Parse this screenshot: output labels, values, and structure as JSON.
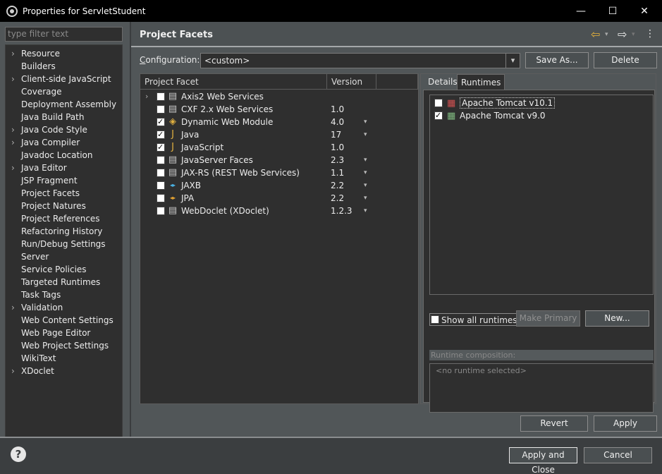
{
  "window": {
    "title": "Properties for ServletStudent",
    "minimize": "—",
    "maximize": "☐",
    "close": "✕"
  },
  "filter": {
    "placeholder": "type filter text"
  },
  "tree": [
    {
      "label": "Resource",
      "expandable": true
    },
    {
      "label": "Builders",
      "expandable": false
    },
    {
      "label": "Client-side JavaScript",
      "expandable": true
    },
    {
      "label": "Coverage",
      "expandable": false
    },
    {
      "label": "Deployment Assembly",
      "expandable": false
    },
    {
      "label": "Java Build Path",
      "expandable": false
    },
    {
      "label": "Java Code Style",
      "expandable": true
    },
    {
      "label": "Java Compiler",
      "expandable": true
    },
    {
      "label": "Javadoc Location",
      "expandable": false
    },
    {
      "label": "Java Editor",
      "expandable": true
    },
    {
      "label": "JSP Fragment",
      "expandable": false
    },
    {
      "label": "Project Facets",
      "expandable": false,
      "selected": true
    },
    {
      "label": "Project Natures",
      "expandable": false
    },
    {
      "label": "Project References",
      "expandable": false
    },
    {
      "label": "Refactoring History",
      "expandable": false
    },
    {
      "label": "Run/Debug Settings",
      "expandable": false
    },
    {
      "label": "Server",
      "expandable": false
    },
    {
      "label": "Service Policies",
      "expandable": false
    },
    {
      "label": "Targeted Runtimes",
      "expandable": false
    },
    {
      "label": "Task Tags",
      "expandable": false
    },
    {
      "label": "Validation",
      "expandable": true
    },
    {
      "label": "Web Content Settings",
      "expandable": false
    },
    {
      "label": "Web Page Editor",
      "expandable": false
    },
    {
      "label": "Web Project Settings",
      "expandable": false
    },
    {
      "label": "WikiText",
      "expandable": false
    },
    {
      "label": "XDoclet",
      "expandable": true
    }
  ],
  "header": {
    "title": "Project Facets"
  },
  "config": {
    "label": "Configuration:",
    "value": "<custom>",
    "save_as": "Save As...",
    "delete": "Delete"
  },
  "facets": {
    "col_facet": "Project Facet",
    "col_version": "Version",
    "rows": [
      {
        "name": "Axis2 Web Services",
        "version": "",
        "checked": false,
        "expandable": true,
        "icon": "page-icon",
        "dropdown": false
      },
      {
        "name": "CXF 2.x Web Services",
        "version": "1.0",
        "checked": false,
        "expandable": false,
        "icon": "page-icon",
        "dropdown": false
      },
      {
        "name": "Dynamic Web Module",
        "version": "4.0",
        "checked": true,
        "expandable": false,
        "icon": "web-module-icon",
        "dropdown": true
      },
      {
        "name": "Java",
        "version": "17",
        "checked": true,
        "expandable": false,
        "icon": "java-icon",
        "dropdown": true
      },
      {
        "name": "JavaScript",
        "version": "1.0",
        "checked": true,
        "expandable": false,
        "icon": "javascript-icon",
        "dropdown": false
      },
      {
        "name": "JavaServer Faces",
        "version": "2.3",
        "checked": false,
        "expandable": false,
        "icon": "page-icon",
        "dropdown": true
      },
      {
        "name": "JAX-RS (REST Web Services)",
        "version": "1.1",
        "checked": false,
        "expandable": false,
        "icon": "page-icon",
        "dropdown": true
      },
      {
        "name": "JAXB",
        "version": "2.2",
        "checked": false,
        "expandable": false,
        "icon": "jaxb-icon",
        "dropdown": true
      },
      {
        "name": "JPA",
        "version": "2.2",
        "checked": false,
        "expandable": false,
        "icon": "jpa-icon",
        "dropdown": true
      },
      {
        "name": "WebDoclet (XDoclet)",
        "version": "1.2.3",
        "checked": false,
        "expandable": false,
        "icon": "page-icon",
        "dropdown": true
      }
    ]
  },
  "tabs": {
    "details": "Details",
    "runtimes": "Runtimes"
  },
  "runtimes": [
    {
      "name": "Apache Tomcat v10.1",
      "checked": false
    },
    {
      "name": "Apache Tomcat v9.0",
      "checked": true
    }
  ],
  "show_all": "Show all runtimes",
  "make_primary": "Make Primary",
  "new_btn": "New...",
  "runtime_composition": {
    "label": "Runtime composition:",
    "empty": "<no runtime selected>"
  },
  "revert": "Revert",
  "apply": "Apply",
  "apply_close": "Apply and Close",
  "cancel": "Cancel",
  "help": "?"
}
